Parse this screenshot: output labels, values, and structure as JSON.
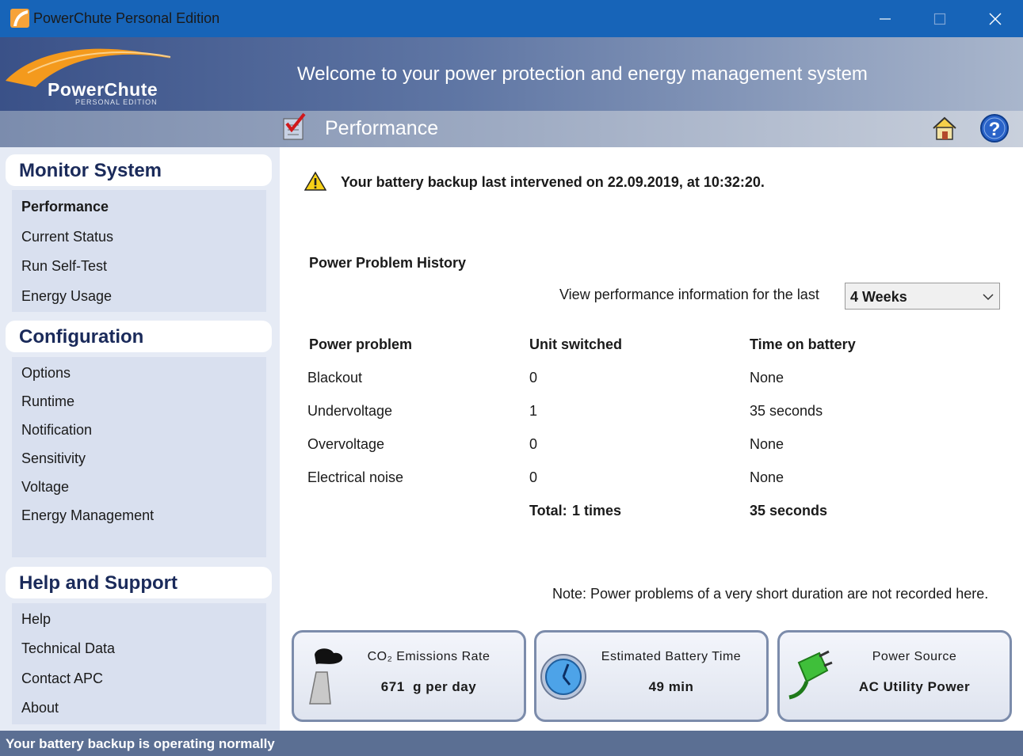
{
  "window": {
    "title": "PowerChute Personal Edition"
  },
  "header": {
    "logo_name": "PowerChute",
    "logo_sub": "PERSONAL EDITION",
    "welcome": "Welcome to your power protection and energy management system"
  },
  "section": {
    "title": "Performance"
  },
  "sidebar": {
    "groups": [
      {
        "title": "Monitor System",
        "items": [
          "Performance",
          "Current Status",
          "Run Self-Test",
          "Energy Usage"
        ]
      },
      {
        "title": "Configuration",
        "items": [
          "Options",
          "Runtime",
          "Notification",
          "Sensitivity",
          "Voltage",
          "Energy Management"
        ]
      },
      {
        "title": "Help and Support",
        "items": [
          "Help",
          "Technical Data",
          "Contact APC",
          "About"
        ]
      }
    ],
    "active_item": "Performance"
  },
  "main": {
    "alert": "Your battery backup last intervened on 22.09.2019, at 10:32:20.",
    "history_title": "Power Problem History",
    "view_label": "View performance information for the last",
    "period_selected": "4 Weeks",
    "table": {
      "headers": [
        "Power problem",
        "Unit switched",
        "Time on battery"
      ],
      "rows": [
        [
          "Blackout",
          "0",
          "None"
        ],
        [
          "Undervoltage",
          "1",
          "35 seconds"
        ],
        [
          "Overvoltage",
          "0",
          "None"
        ],
        [
          "Electrical noise",
          "0",
          "None"
        ]
      ],
      "total_label": "Total:",
      "total_times": "1 times",
      "total_time": "35 seconds"
    },
    "note": "Note: Power problems of a very short duration are not recorded here."
  },
  "cards": [
    {
      "label": "CO₂ Emissions Rate",
      "value": "671  g per day",
      "icon": "factory-smoke-icon"
    },
    {
      "label": "Estimated Battery Time",
      "value": "49 min",
      "icon": "clock-icon"
    },
    {
      "label": "Power Source",
      "value": "AC Utility Power",
      "icon": "power-plug-icon"
    }
  ],
  "status": {
    "text": "Your battery backup is operating normally"
  },
  "colors": {
    "titlebar": "#1764b8",
    "header_dark": "#3a5188",
    "sidebar_bg": "#e6ebf5",
    "status_bg": "#5b6f93"
  }
}
